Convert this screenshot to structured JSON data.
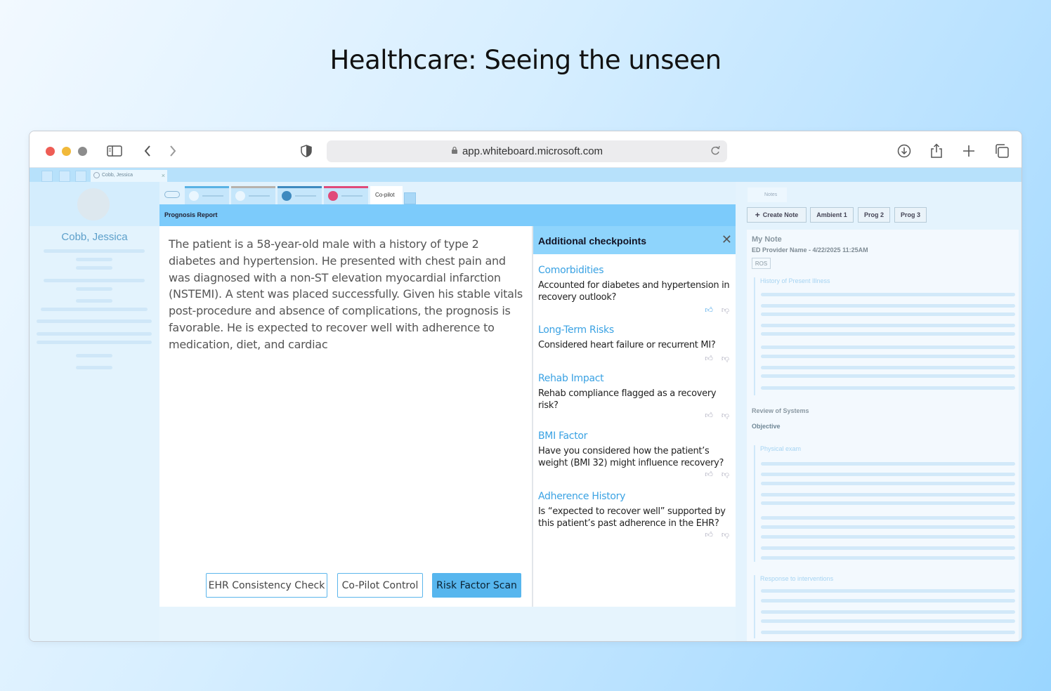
{
  "headline": "Healthcare: Seeing the unseen",
  "browser": {
    "url": "app.whiteboard.microsoft.com",
    "icons": [
      "sidebar-icon",
      "back-icon",
      "forward-icon",
      "shield-icon",
      "lock-icon",
      "reload-icon",
      "download-icon",
      "share-icon",
      "new-tab-icon",
      "tabs-overview-icon"
    ]
  },
  "app_tab": {
    "label": "Cobb, Jessica",
    "close": "×"
  },
  "patient": {
    "name": "Cobb, Jessica"
  },
  "co_pilot_tab": "Co-pilot",
  "report": {
    "title": "Prognosis Report",
    "text": "The patient is a 58-year-old male with a history of type 2 diabetes and hypertension. He presented with chest pain and was diagnosed with a non-ST elevation myocardial infarction (NSTEMI). A stent was placed successfully. Given his stable vitals post-procedure and absence of complications, the prognosis is favorable. He is expected to recover well with adherence to medication, diet, and cardiac",
    "buttons": [
      "EHR Consistency Check",
      "Co-Pilot Control",
      "Risk Factor Scan"
    ]
  },
  "checkpoints": {
    "title": "Additional checkpoints",
    "close": "✕",
    "items": [
      {
        "title": "Comorbidities",
        "body": "Accounted for diabetes and hypertension in recovery outlook?",
        "liked": true
      },
      {
        "title": "Long-Term Risks",
        "body": "Considered heart failure or recurrent MI?",
        "liked": false
      },
      {
        "title": "Rehab Impact",
        "body": "Rehab compliance flagged as a recovery risk?",
        "liked": false
      },
      {
        "title": "BMI Factor",
        "body": "Have you considered how the patient’s weight (BMI 32) might influence recovery?",
        "liked": false
      },
      {
        "title": "Adherence History",
        "body": "Is “expected to recover well” supported by this patient’s past adherence in the EHR?",
        "liked": false
      }
    ]
  },
  "notes": {
    "tab": "Notes",
    "buttons": [
      "Create Note",
      "Ambient 1",
      "Prog 2",
      "Prog 3"
    ],
    "note_title": "My Note",
    "provider_line": "ED Provider Name - 4/22/2025 11:25AM",
    "ros_tag": "ROS",
    "sections": {
      "hpi": "History of Present Illness",
      "review": "Review of Systems",
      "objective": "Objective",
      "physical": "Physical exam",
      "response": "Response to interventions"
    }
  },
  "colors": {
    "accent": "#57b6ee",
    "header": "#7ccbfb",
    "link": "#3aa2e3"
  }
}
